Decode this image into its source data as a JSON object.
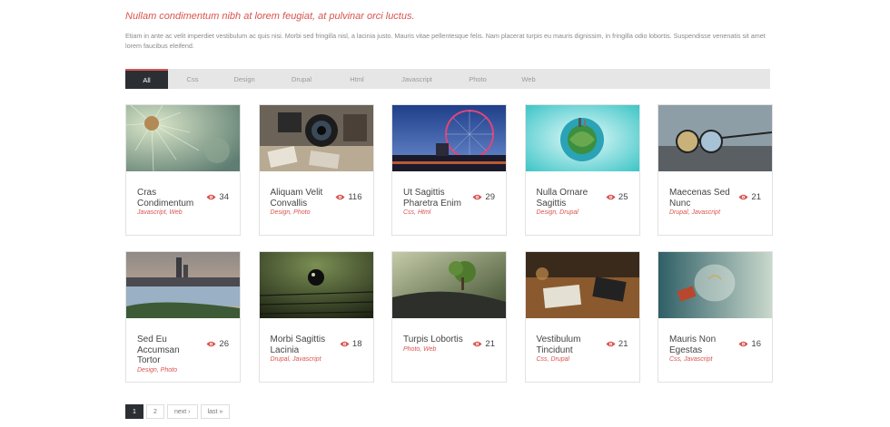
{
  "header": {
    "tagline": "Nullam condimentum nibh at lorem feugiat, at pulvinar orci luctus.",
    "intro": "Etiam in ante ac velit imperdiet vestibulum ac quis nisi. Morbi sed fringilla nisl, a lacinia justo. Mauris vitae pellentesque felis. Nam placerat turpis eu mauris dignissim, in fringilla odio lobortis. Suspendisse venenatis sit amet lorem faucibus eleifend."
  },
  "filters": [
    "All",
    "Css",
    "Design",
    "Drupal",
    "Html",
    "Javascript",
    "Photo",
    "Web"
  ],
  "items": [
    {
      "title": "Cras Condimentum",
      "cats": "Javascript, Web",
      "views": "34",
      "thumb": "dandelion"
    },
    {
      "title": "Aliquam Velit Convallis",
      "cats": "Design, Photo",
      "views": "116",
      "thumb": "camera"
    },
    {
      "title": "Ut Sagittis Pharetra Enim",
      "cats": "Css, Html",
      "views": "29",
      "thumb": "ferris-wheel"
    },
    {
      "title": "Nulla Ornare Sagittis",
      "cats": "Design, Drupal",
      "views": "25",
      "thumb": "globe-city"
    },
    {
      "title": "Maecenas Sed Nunc",
      "cats": "Drupal, Javascript",
      "views": "21",
      "thumb": "glasses"
    },
    {
      "title": "Sed Eu Accumsan Tortor",
      "cats": "Design, Photo",
      "views": "26",
      "thumb": "city-river"
    },
    {
      "title": "Morbi Sagittis Lacinia",
      "cats": "Drupal, Javascript",
      "views": "18",
      "thumb": "marble"
    },
    {
      "title": "Turpis Lobortis",
      "cats": "Photo, Web",
      "views": "21",
      "thumb": "bonsai"
    },
    {
      "title": "Vestibulum Tincidunt",
      "cats": "Css, Drupal",
      "views": "21",
      "thumb": "desk"
    },
    {
      "title": "Mauris Non Egestas",
      "cats": "Css, Javascript",
      "views": "16",
      "thumb": "lightbulb"
    }
  ],
  "pager": {
    "page1": "1",
    "page2": "2",
    "next": "next ›",
    "last": "last »"
  },
  "colors": {
    "accent": "#d9534f",
    "dark": "#2b2f33",
    "bar": "#e6e6e6"
  }
}
